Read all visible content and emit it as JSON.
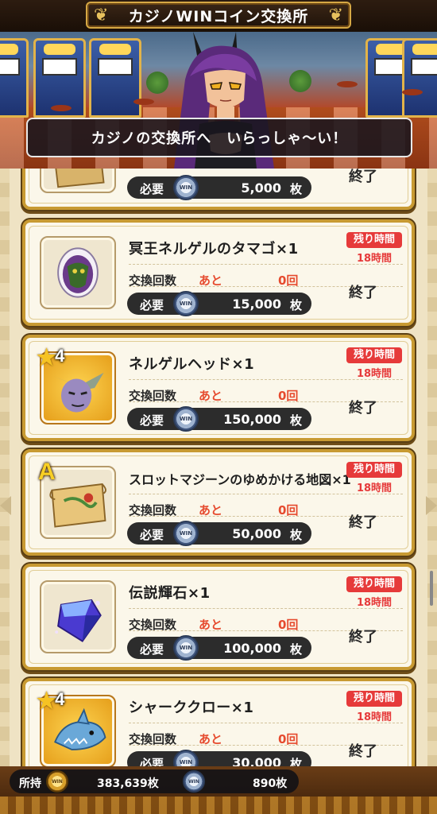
{
  "header": {
    "title": "カジノWINコイン交換所"
  },
  "scene": {
    "speech": "カジノの交換所へ　いらっしゃ～い！"
  },
  "colors": {
    "accent_gold": "#c89a32",
    "time_red": "#e63a3a",
    "panel_cream": "#fbf7ea"
  },
  "labels": {
    "exchange_count": "交換回数",
    "remaining_prefix": "あと",
    "required": "必要",
    "unit": "枚",
    "time_left": "残り時間",
    "coin_mark": "WIN"
  },
  "items": [
    {
      "name": "",
      "remaining": "",
      "cost": "5,000",
      "time": "",
      "status": "終了",
      "icon": "treasure-map-icon",
      "rank": ""
    },
    {
      "name": "冥王ネルゲルのタマゴ×1",
      "remaining": "0回",
      "cost": "15,000",
      "time": "18時間",
      "status": "終了",
      "icon": "monster-egg-icon",
      "rank": ""
    },
    {
      "name": "ネルゲルヘッド×1",
      "remaining": "0回",
      "cost": "150,000",
      "time": "18時間",
      "status": "終了",
      "icon": "nergel-head-icon",
      "rank": "4"
    },
    {
      "name": "スロットマジーンのゆめかける地図×1",
      "remaining": "0回",
      "cost": "50,000",
      "time": "18時間",
      "status": "終了",
      "icon": "treasure-map-icon",
      "rank": "A"
    },
    {
      "name": "伝説輝石×1",
      "remaining": "0回",
      "cost": "100,000",
      "time": "18時間",
      "status": "終了",
      "icon": "legend-crystal-icon",
      "rank": ""
    },
    {
      "name": "シャーククロー×1",
      "remaining": "0回",
      "cost": "30,000",
      "time": "18時間",
      "status": "終了",
      "icon": "shark-claw-icon",
      "rank": "4"
    }
  ],
  "footer": {
    "label": "所持",
    "gold_amount": "383,639枚",
    "silver_amount": "890枚"
  }
}
